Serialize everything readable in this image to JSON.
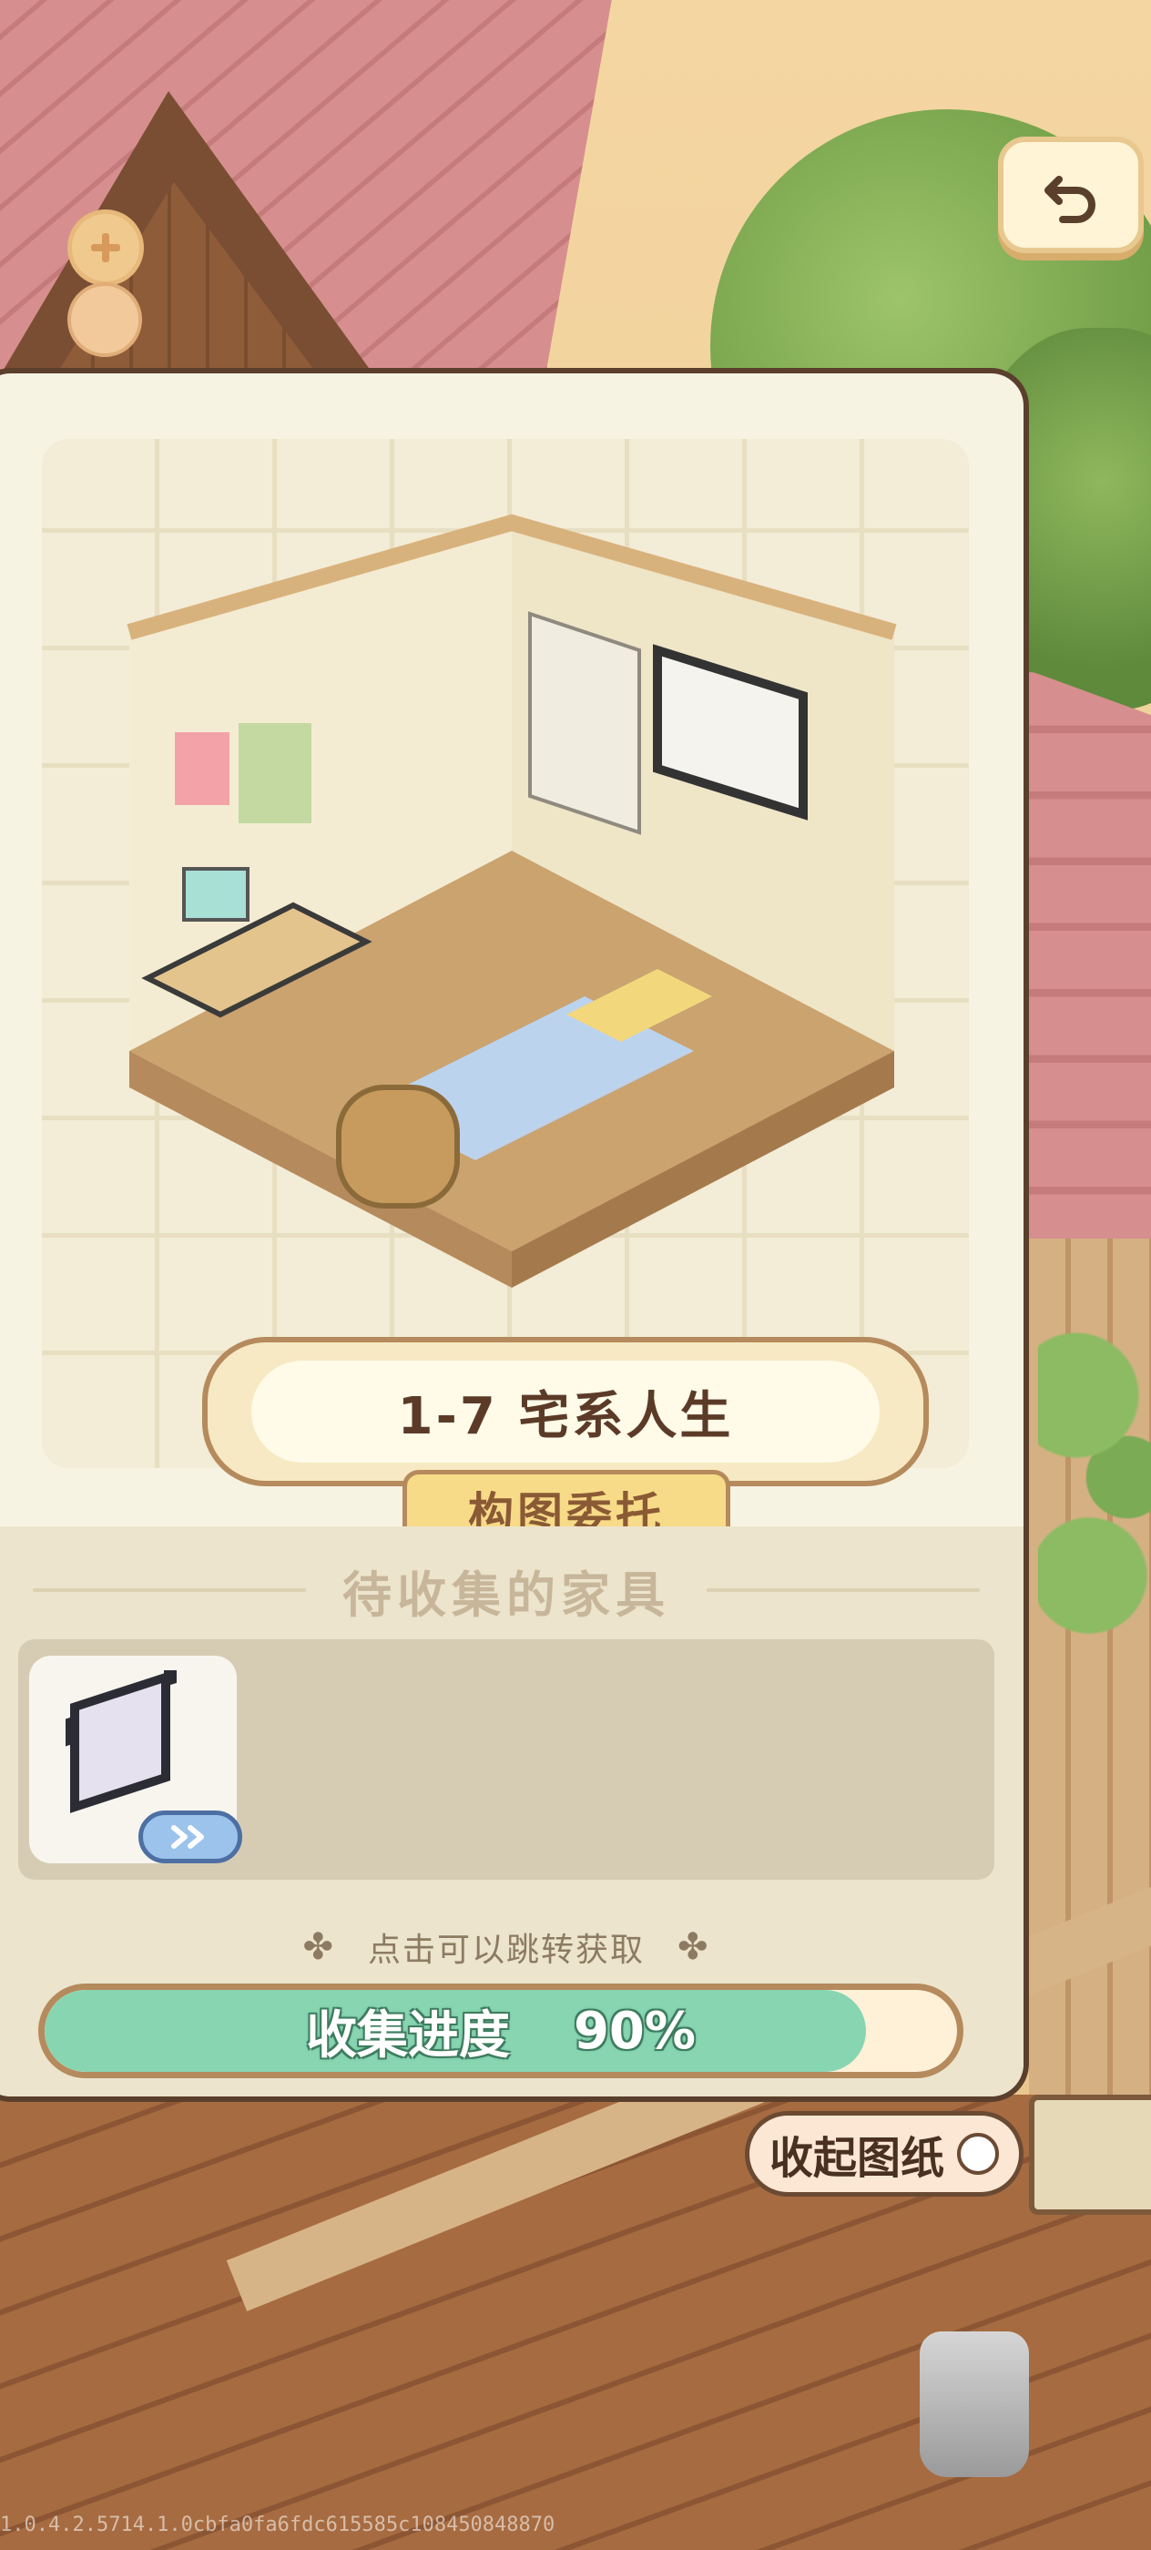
{
  "level": {
    "title": "1-7 宅系人生",
    "subtitle": "构图委托"
  },
  "collection": {
    "header": "待收集的家具",
    "items": [
      {
        "name": "projector-screen",
        "icon": "projector-screen-icon",
        "badge_icon": "double-chevron-right-icon"
      }
    ],
    "hint": "点击可以跳转获取",
    "progress_label": "收集进度",
    "progress_value": "90%",
    "progress_fraction": 0.9
  },
  "buttons": {
    "collapse_label": "收起图纸",
    "back_icon": "undo-arrow-icon",
    "zoom_icon": "plus-icon"
  },
  "footer": {
    "version": "1.0.4.2.5714.1.0cbfa0fa6fdc615585c108450848870"
  },
  "colors": {
    "progress_fill": "#88d5b2",
    "panel_bg": "#f7f3e2",
    "panel_border": "#5a3f2c",
    "badge_blue": "#9bc3ec"
  }
}
